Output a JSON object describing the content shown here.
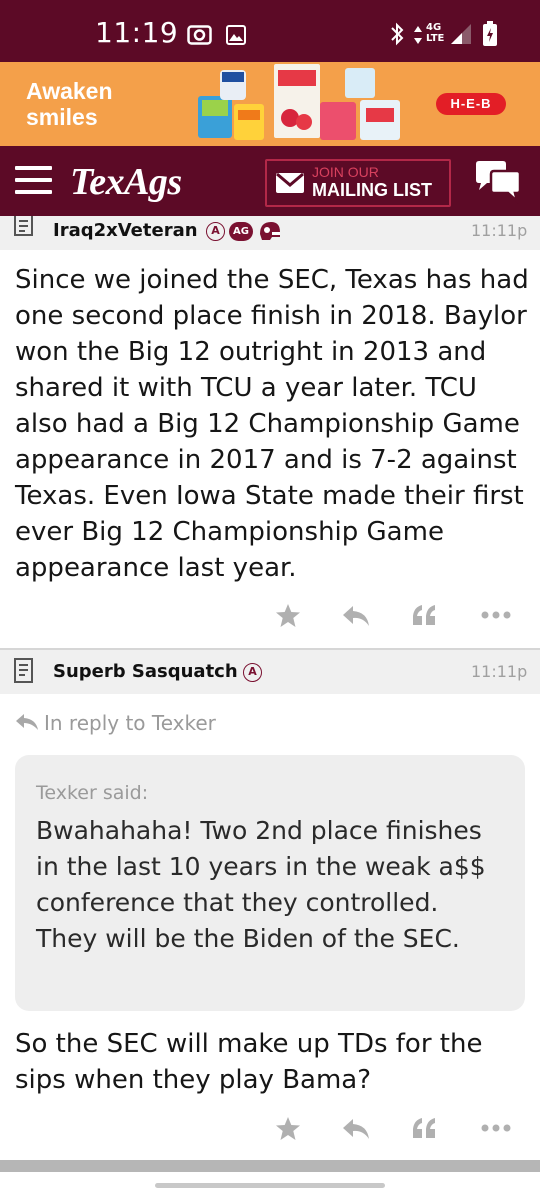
{
  "status_bar": {
    "time": "11:19",
    "network_label": "4G LTE",
    "icons": [
      "record-icon",
      "image-icon",
      "bluetooth-icon",
      "signal-icon",
      "battery-icon"
    ]
  },
  "ad": {
    "tagline_line1": "Awaken",
    "tagline_line2": "smiles",
    "advertiser": "H-E-B",
    "background": "#f4a04a"
  },
  "header": {
    "brand": "TexAgs",
    "mailing_line1": "JOIN OUR",
    "mailing_line2": "MAILING LIST",
    "background": "#5c0a26"
  },
  "posts": [
    {
      "author": "Iraq2xVeteran",
      "badges": [
        "A",
        "AG"
      ],
      "time": "11:11p",
      "body": "Since we joined the SEC, Texas has had one second place finish in 2018. Baylor won the Big 12 outright in 2013 and shared it with TCU a year later. TCU also had a Big 12 Championship Game appearance in 2017 and is 7-2 against Texas. Even Iowa State made their first ever Big 12 Championship Game appearance last year."
    },
    {
      "author": "Superb Sasquatch",
      "badges": [
        "A"
      ],
      "time": "11:11p",
      "reply_to": "In reply to Texker",
      "quote_author": "Texker said:",
      "quote_body": "Bwahahaha! Two 2nd place finishes in the last 10 years in the weak a$$ conference that they controlled. They will be the Biden of the SEC.",
      "body": "So the SEC will make up TDs for the sips when they play Bama?"
    }
  ],
  "colors": {
    "maroon": "#5c0a26",
    "accent": "#7a1131",
    "muted": "#a0a0a0"
  }
}
